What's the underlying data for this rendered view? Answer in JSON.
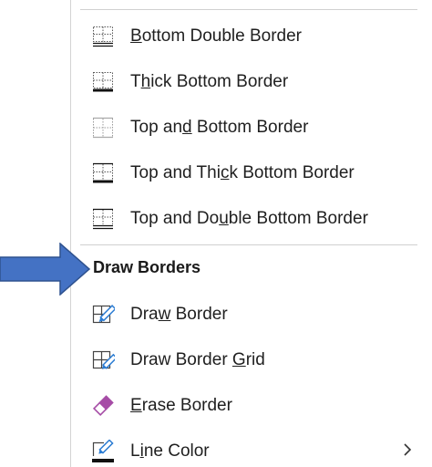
{
  "menu": {
    "items": [
      {
        "pre": "",
        "u": "B",
        "post": "ottom Double Border",
        "icon": "bottom-double-border-icon"
      },
      {
        "pre": "T",
        "u": "h",
        "post": "ick Bottom Border",
        "icon": "thick-bottom-border-icon"
      },
      {
        "pre": "Top an",
        "u": "d",
        "post": " Bottom Border",
        "icon": "top-and-bottom-border-icon"
      },
      {
        "pre": "Top and Thi",
        "u": "c",
        "post": "k Bottom Border",
        "icon": "top-and-thick-bottom-border-icon"
      },
      {
        "pre": "Top and Do",
        "u": "u",
        "post": "ble Bottom Border",
        "icon": "top-and-double-bottom-border-icon"
      }
    ],
    "section_heading": "Draw Borders",
    "draw_items": [
      {
        "pre": "Dra",
        "u": "w",
        "post": " Border",
        "icon": "draw-border-icon"
      },
      {
        "pre": "Draw Border ",
        "u": "G",
        "post": "rid",
        "icon": "draw-border-grid-icon"
      },
      {
        "pre": "",
        "u": "E",
        "post": "rase Border",
        "icon": "eraser-icon"
      },
      {
        "pre": "L",
        "u": "i",
        "post": "ne Color",
        "icon": "line-color-icon"
      }
    ]
  },
  "colors": {
    "arrow": "#4472c4",
    "arrow_outline": "#2f528f",
    "eraser": "#a64ca6",
    "pen": "#2b7cd3"
  }
}
